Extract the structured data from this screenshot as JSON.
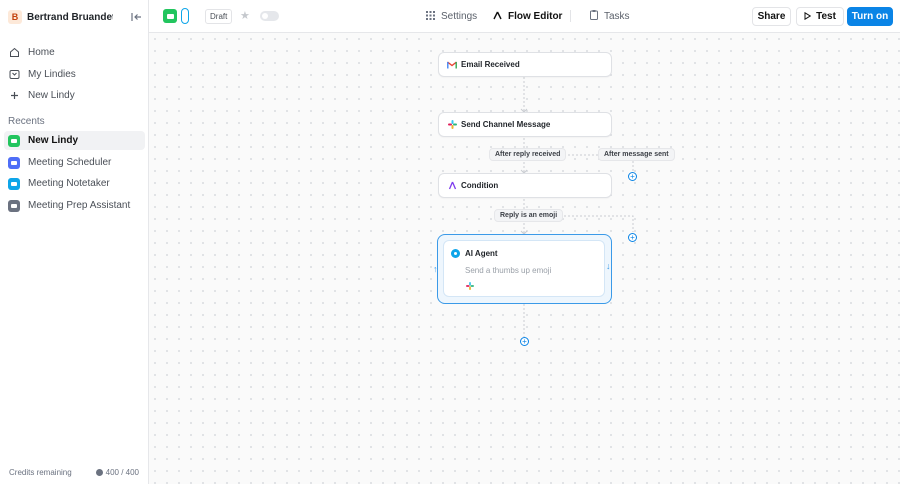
{
  "workspace": {
    "initial": "B",
    "name": "Bertrand Bruandet's Wo"
  },
  "nav": [
    {
      "label": "Home",
      "icon": "home-icon"
    },
    {
      "label": "My Lindies",
      "icon": "folder-icon"
    },
    {
      "label": "New Lindy",
      "icon": "plus-icon"
    }
  ],
  "recents": {
    "label": "Recents",
    "items": [
      {
        "label": "New Lindy",
        "color": "#22c55e",
        "active": true
      },
      {
        "label": "Meeting Scheduler",
        "color": "#4f6ef7",
        "active": false
      },
      {
        "label": "Meeting Notetaker",
        "color": "#0ea5e9",
        "active": false
      },
      {
        "label": "Meeting Prep Assistant",
        "color": "#6b7280",
        "active": false
      }
    ]
  },
  "credits": {
    "label": "Credits remaining",
    "value": "400 / 400"
  },
  "topbar": {
    "draft": "Draft",
    "tabs": [
      {
        "label": "Settings",
        "icon": "grid-icon"
      },
      {
        "label": "Flow Editor",
        "icon": "flow-icon"
      },
      {
        "label": "Tasks",
        "icon": "clipboard-icon"
      }
    ],
    "share": "Share",
    "test": "Test",
    "turn_on": "Turn on"
  },
  "flow": {
    "email_node": "Email Received",
    "send_node": "Send Channel Message",
    "label_reply": "After reply received",
    "label_sent": "After message sent",
    "condition_node": "Condition",
    "label_emoji": "Reply is an emoji",
    "agent_title": "AI Agent",
    "agent_sub": "Send a thumbs up emoji"
  },
  "colors": {
    "accent": "#0a84e6",
    "agent_border": "#3b9ae8"
  }
}
